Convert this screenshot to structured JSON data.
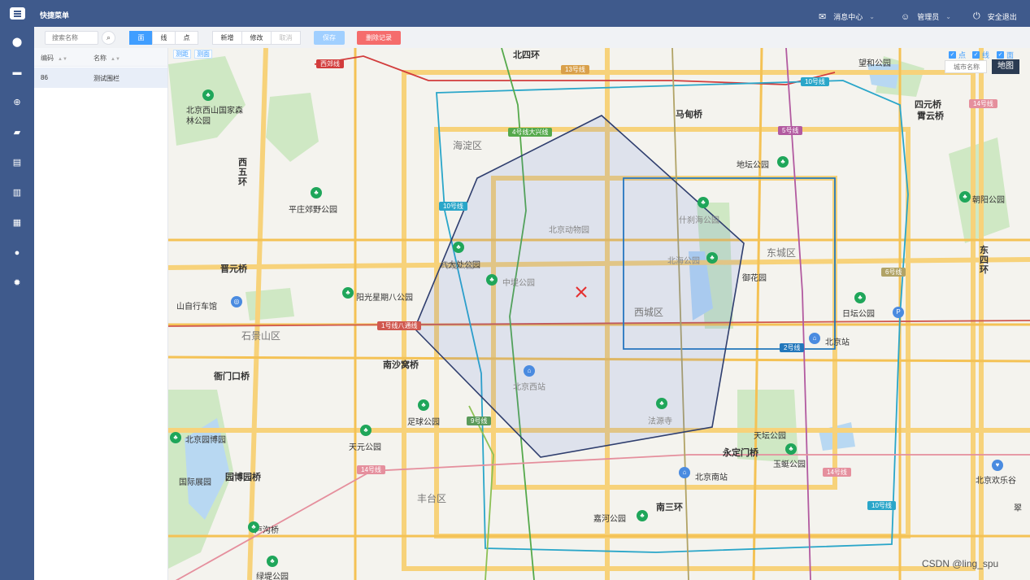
{
  "topbar": {
    "title": "快捷菜单",
    "messages": "消息中心",
    "user": "管理员",
    "logout": "安全退出"
  },
  "toolbar": {
    "search_placeholder": "搜索名称",
    "shape_tabs": [
      "面",
      "线",
      "点"
    ],
    "actions": [
      "新增",
      "修改",
      "取消"
    ],
    "save": "保存",
    "delete": "删除记录"
  },
  "table": {
    "columns": [
      "编码",
      "名称"
    ],
    "rows": [
      {
        "code": "86",
        "name": "测试围栏"
      }
    ]
  },
  "map": {
    "measure_distance": "测距",
    "measure_area": "测面",
    "layers": [
      "点",
      "线",
      "面"
    ],
    "city_placeholder": "城市名称",
    "map_type": "地图",
    "watermark": "CSDN @ling_spu",
    "districts": [
      "海淀区",
      "东城区",
      "西城区",
      "石景山区",
      "丰台区"
    ],
    "labels": [
      "北四环",
      "马甸桥",
      "四元桥",
      "霄云桥",
      "望和公园",
      "北京西山国家森林公园",
      "西五环",
      "平庄郊野公园",
      "晋元桥",
      "八大处公园",
      "山自行车馆",
      "阳光星期八公园",
      "南沙窝桥",
      "衙门口桥",
      "足球公园",
      "天元公园",
      "北京园博园",
      "园博园桥",
      "国际展园",
      "卢沟桥",
      "绿堤公园",
      "北京动物园",
      "玲珑公园",
      "中堤公园",
      "北京西站",
      "法源寺",
      "什刹海公园",
      "北海公园",
      "御花园",
      "地坛公园",
      "日坛公园",
      "北京站",
      "天坛公园",
      "永定门桥",
      "玉蜓公园",
      "北京南站",
      "嘉河公园",
      "南三环",
      "朝阳公园",
      "东四环",
      "北京欢乐谷",
      "翠"
    ],
    "line_tags": [
      "西郊线",
      "13号线",
      "10号线",
      "14号线",
      "4号线大兴线",
      "5号线",
      "10号线",
      "6号线",
      "1号线八通线",
      "2号线",
      "9号线",
      "14号线",
      "14号线",
      "10号线"
    ]
  },
  "colors": {
    "primary": "#3f5a8c",
    "accent": "#409eff",
    "danger": "#f56c6c"
  }
}
